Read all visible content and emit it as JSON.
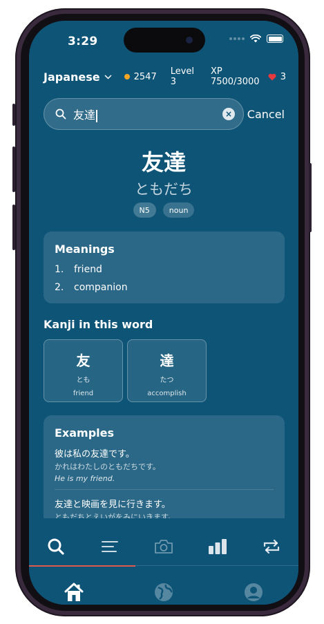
{
  "status": {
    "time": "3:29"
  },
  "header": {
    "language": "Japanese",
    "coins": "2547",
    "level": "Level 3",
    "xp": "XP 7500/3000",
    "lives": "3"
  },
  "search": {
    "query": "友達",
    "clear_label": "×",
    "cancel_label": "Cancel"
  },
  "entry": {
    "word": "友達",
    "reading": "ともだち",
    "tags": [
      "N5",
      "noun"
    ]
  },
  "meanings": {
    "title": "Meanings",
    "items": [
      {
        "num": "1.",
        "text": "friend"
      },
      {
        "num": "2.",
        "text": "companion"
      }
    ]
  },
  "kanji_section": {
    "title": "Kanji in this word",
    "items": [
      {
        "char": "友",
        "reading": "とも",
        "meaning": "friend"
      },
      {
        "char": "達",
        "reading": "たつ",
        "meaning": "accomplish"
      }
    ]
  },
  "examples": {
    "title": "Examples",
    "items": [
      {
        "jp": "彼は私の友達です。",
        "kana": "かれはわたしのともだちです。",
        "en": "He is my friend."
      },
      {
        "jp": "友達と映画を見に行きます。",
        "kana": "ともだちとえいがをみにいきます。",
        "en": ""
      }
    ]
  },
  "tabs": {
    "active": "search",
    "items": [
      "search-icon",
      "list-icon",
      "camera-icon",
      "bar-chart-icon",
      "repeat-icon"
    ]
  },
  "bottom_nav": {
    "items": [
      "home-icon",
      "globe-icon",
      "profile-icon"
    ]
  },
  "colors": {
    "background": "#0e5477",
    "accent": "#e05a4f",
    "coin": "#f5a623",
    "heart": "#e6383f"
  }
}
